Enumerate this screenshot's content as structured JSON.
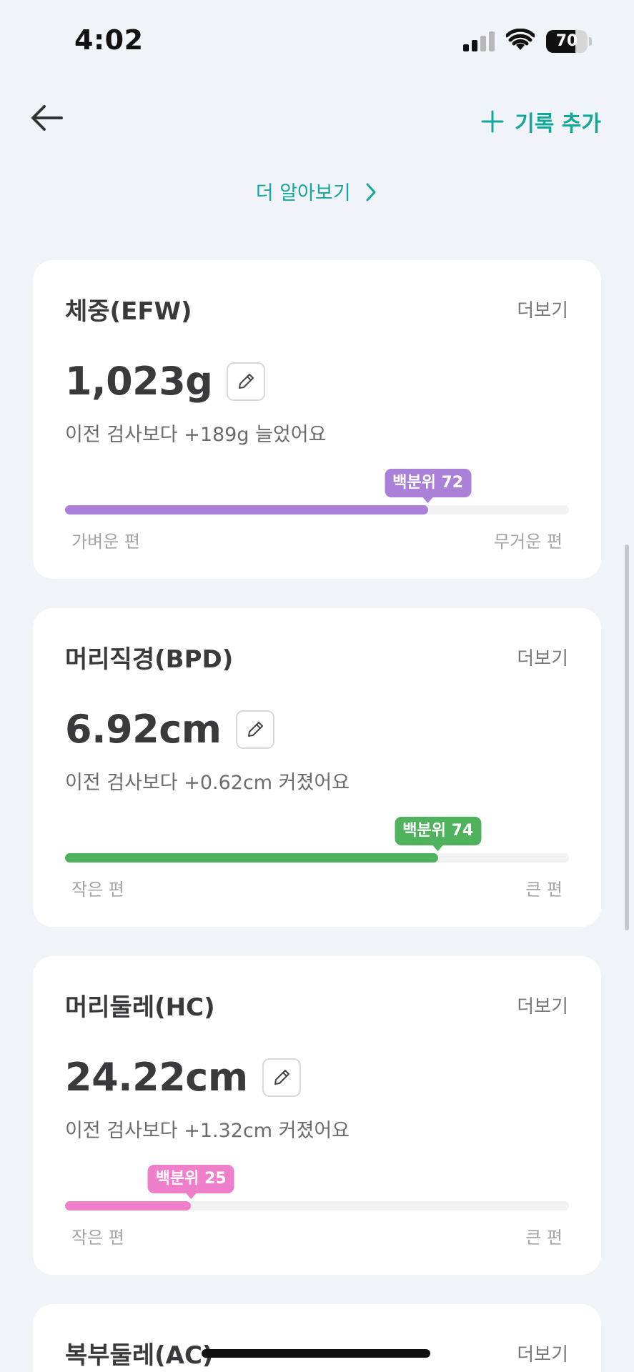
{
  "status_bar": {
    "time": "4:02",
    "battery": "70",
    "battery_level": 0.7
  },
  "header": {
    "back_icon": "arrow-left-icon",
    "add_label": "기록 추가",
    "add_icon": "plus-icon"
  },
  "learn_more": {
    "label": "더 알아보기",
    "icon": "chevron-right-icon"
  },
  "colors": {
    "accent": "#14a89b",
    "weight": "#ab80d9",
    "bpd": "#4fb35e",
    "hc": "#f07fcb"
  },
  "cards": [
    {
      "title": "체중(EFW)",
      "more": "더보기",
      "value": "1,023g",
      "change": "이전 검사보다 +189g 늘었어요",
      "percentile_label": "백분위 72",
      "percentile": 72,
      "scale_left": "가벼운 편",
      "scale_right": "무거운 편",
      "color": "#ab80d9"
    },
    {
      "title": "머리직경(BPD)",
      "more": "더보기",
      "value": "6.92cm",
      "change": "이전 검사보다 +0.62cm 커졌어요",
      "percentile_label": "백분위 74",
      "percentile": 74,
      "scale_left": "작은 편",
      "scale_right": "큰 편",
      "color": "#4fb35e"
    },
    {
      "title": "머리둘레(HC)",
      "more": "더보기",
      "value": "24.22cm",
      "change": "이전 검사보다 +1.32cm 커졌어요",
      "percentile_label": "백분위 25",
      "percentile": 25,
      "scale_left": "작은 편",
      "scale_right": "큰 편",
      "color": "#f07fcb"
    },
    {
      "title": "복부둘레(AC)",
      "more": "더보기"
    }
  ]
}
